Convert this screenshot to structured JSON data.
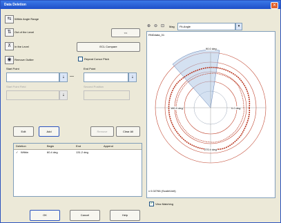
{
  "window": {
    "title": "Data Deletion"
  },
  "sidebar": {
    "within_angle_range": "Within Angle Range",
    "out_of_level": "Out of the Level",
    "in_level": "In the Level",
    "remove_outlier": "Remove Outlier",
    "ecl_compare": "ECL Compare",
    "repeat_cursor_pitch": "Repeat Cursor Pitch",
    "start_point": "Start Point",
    "end_point": "End Point",
    "start_fields_label": "Start Point Field",
    "end_fields_label": "Second Position"
  },
  "buttons": {
    "edit": "Edit",
    "add": "Add",
    "remove": "Remove",
    "clear_all": "Clear All",
    "ok": "OK",
    "cancel": "Cancel",
    "help": "Help",
    "arrow": "<<"
  },
  "table": {
    "headers": [
      "Deletion",
      "Begin",
      "End",
      "Append"
    ],
    "rows": [
      {
        "deletion": "Within",
        "begin": "60.4 deg",
        "end": "131.2 deg",
        "append": ""
      }
    ]
  },
  "plot": {
    "toolbar": {
      "mag_label": "Mag",
      "mag_value": "Fit-Angle"
    },
    "dataset_label": "RNDdata_01",
    "footer_label": "x 0.02766 (Scale/Unit)",
    "angle_labels": {
      "top": "90.0 deg",
      "left": "180.0 deg",
      "right": "0.0 deg",
      "bottom": "270.0 deg"
    },
    "view_matching": "View Matching",
    "colors": {
      "profile": "#b9361f",
      "circle": "#c0442e",
      "wedge": "#a9c3e3"
    }
  }
}
